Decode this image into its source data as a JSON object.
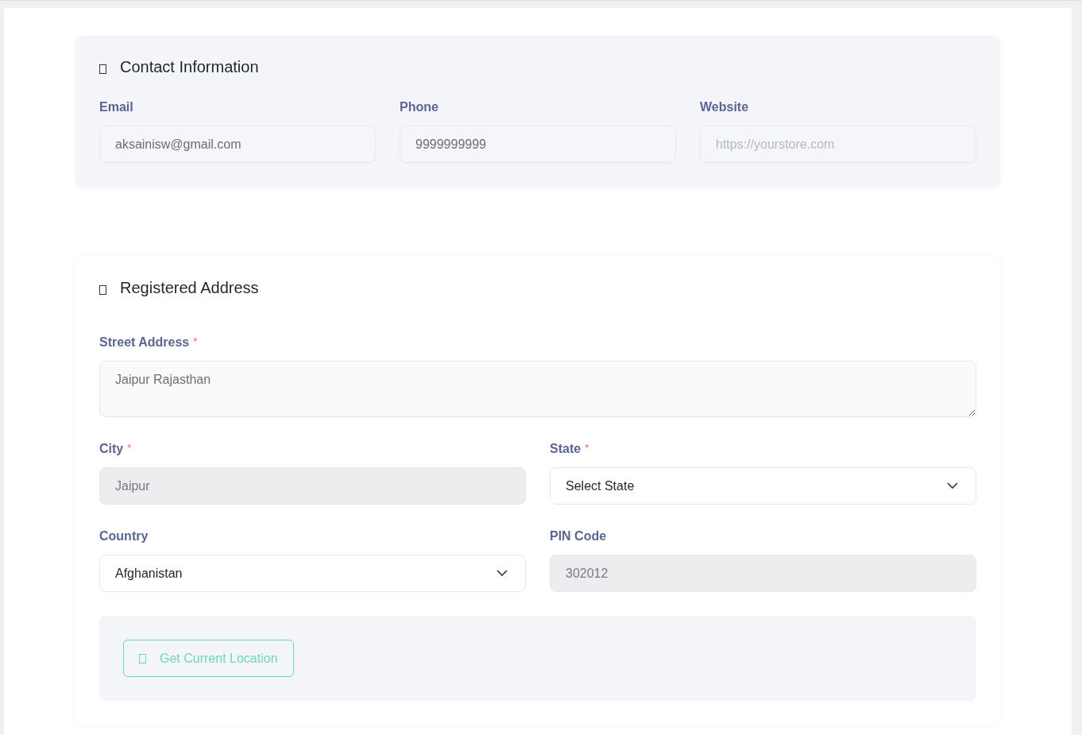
{
  "sections": [
    {
      "title": "Contact Information",
      "tinted": true,
      "fields": [
        {
          "label": "Email",
          "kind": "input",
          "value": "aksainisw@gmail.com",
          "disabled": false
        },
        {
          "label": "Phone",
          "kind": "input",
          "value": "9999999999",
          "disabled": false
        },
        {
          "label": "Website",
          "kind": "input",
          "placeholder": "https://yourstore.com",
          "disabled": false
        }
      ]
    },
    {
      "title": "Registered Address",
      "tinted": false,
      "fields": [
        {
          "label": "Street Address",
          "required_mark": "*",
          "kind": "textarea",
          "value": "Jaipur Rajasthan",
          "disabled": false
        },
        {
          "label": "City",
          "required_mark": "*",
          "kind": "input",
          "value": "Jaipur",
          "disabled": true
        },
        {
          "label": "State",
          "required_mark": "*",
          "kind": "select",
          "value": "Select State",
          "disabled": false
        },
        {
          "label": "Country",
          "kind": "select",
          "value": "Afghanistan",
          "disabled": false
        },
        {
          "label": "PIN Code",
          "kind": "input",
          "value": "302012",
          "disabled": true
        }
      ],
      "location_button": "Get Current Location"
    }
  ]
}
